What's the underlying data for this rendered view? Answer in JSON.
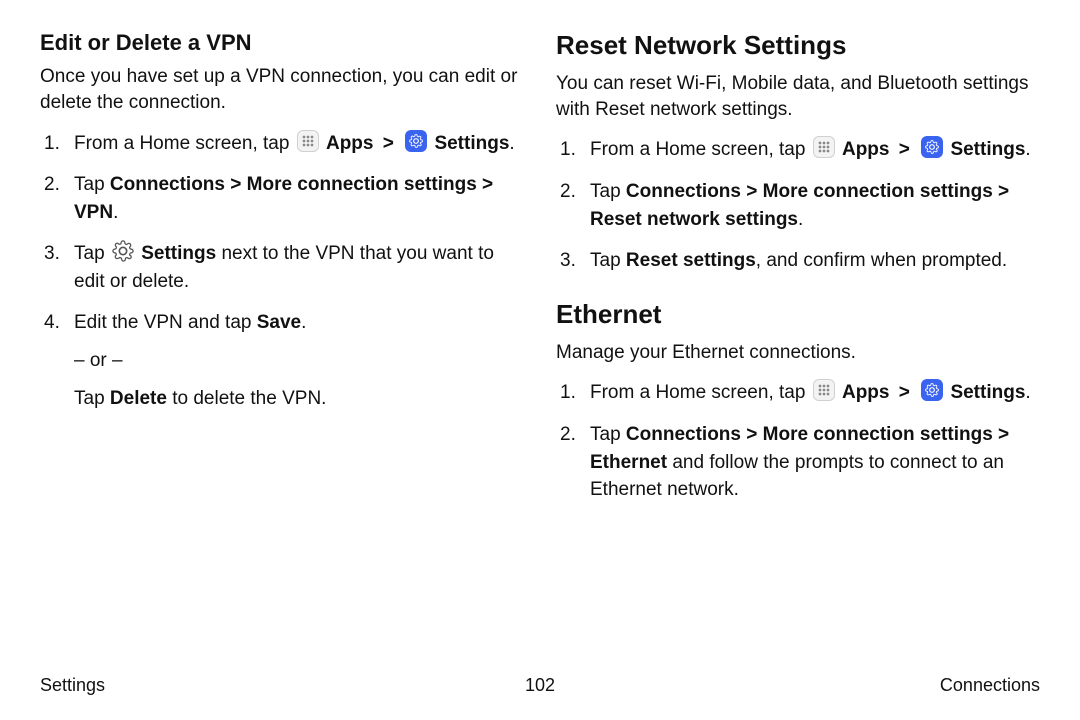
{
  "left": {
    "heading": "Edit or Delete a VPN",
    "intro": "Once you have set up a VPN connection, you can edit or delete the connection.",
    "steps": {
      "s1_prefix": "From a Home screen, tap ",
      "s1_apps": "Apps",
      "s1_settings": "Settings",
      "s2_tap": "Tap ",
      "s2_path": "Connections > More connection settings > VPN",
      "s3_prefix": "Tap ",
      "s3_settings": "Settings",
      "s3_suffix": " next to the VPN that you want to edit or delete.",
      "s4_prefix": "Edit the VPN and tap ",
      "s4_save": "Save",
      "s4_or": "– or –",
      "s4_alt_prefix": "Tap ",
      "s4_alt_delete": "Delete",
      "s4_alt_suffix": " to delete the VPN."
    }
  },
  "right": {
    "resetHeading": "Reset Network Settings",
    "resetIntro": "You can reset Wi-Fi, Mobile data, and Bluetooth settings with Reset network settings.",
    "resetSteps": {
      "s1_prefix": "From a Home screen, tap ",
      "s1_apps": "Apps",
      "s1_settings": "Settings",
      "s2_tap": "Tap ",
      "s2_path": "Connections > More connection settings > Reset network settings",
      "s3_tap": "Tap ",
      "s3_reset": "Reset settings",
      "s3_suffix": ", and confirm when prompted."
    },
    "ethHeading": "Ethernet",
    "ethIntro": "Manage your Ethernet connections.",
    "ethSteps": {
      "s1_prefix": "From a Home screen, tap ",
      "s1_apps": "Apps",
      "s1_settings": "Settings",
      "s2_tap": "Tap ",
      "s2_path": "Connections > More connection settings > Ethernet",
      "s2_suffix": " and follow the prompts to connect to an Ethernet network."
    }
  },
  "footer": {
    "left": "Settings",
    "center": "102",
    "right": "Connections"
  },
  "chev": ">",
  "period": "."
}
